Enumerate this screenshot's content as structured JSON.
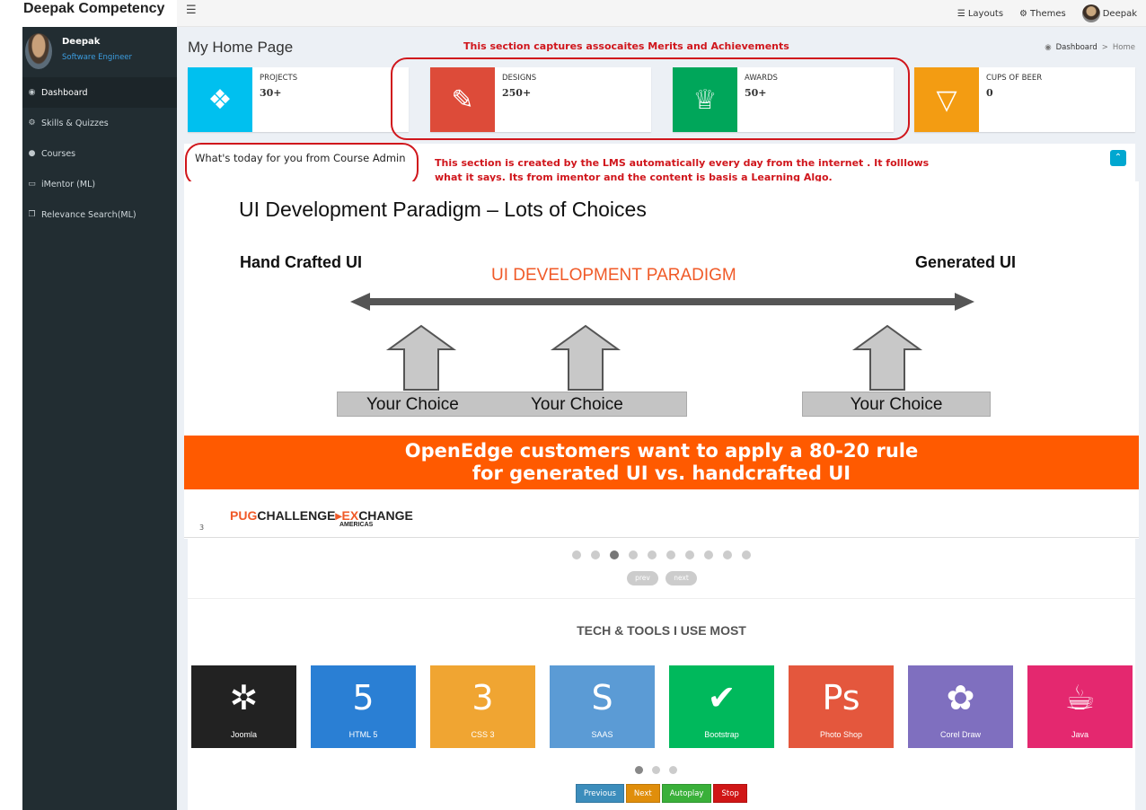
{
  "app": {
    "title": "Deepak Competency"
  },
  "topnav": {
    "layouts": "Layouts",
    "themes": "Themes",
    "user": "Deepak"
  },
  "sidebar": {
    "user_name": "Deepak",
    "user_role": "Software Engineer",
    "items": [
      {
        "label": "Dashboard",
        "icon": "dashboard-icon",
        "active": true
      },
      {
        "label": "Skills & Quizzes",
        "icon": "cogs-icon",
        "active": false
      },
      {
        "label": "Courses",
        "icon": "globe-icon",
        "active": false
      },
      {
        "label": "iMentor (ML)",
        "icon": "laptop-icon",
        "active": false
      },
      {
        "label": "Relevance Search(ML)",
        "icon": "copy-icon",
        "active": false
      }
    ]
  },
  "page": {
    "title": "My Home Page",
    "breadcrumb": [
      "Dashboard",
      "Home"
    ]
  },
  "annotations": {
    "merits": "This section captures assocaites Merits and Achievements",
    "lms": "This section is created by the LMS automatically every day from the internet . It folllows what it says. Its from imentor and the content is basis a Learning Algo."
  },
  "info_boxes": [
    {
      "label": "PROJECTS",
      "value": "30+",
      "color": "#00c0ef",
      "icon": "puzzle-icon"
    },
    {
      "label": "DESIGNS",
      "value": "250+",
      "color": "#dd4b39",
      "icon": "paintbrush-icon"
    },
    {
      "label": "AWARDS",
      "value": "50+",
      "color": "#00a65a",
      "icon": "trophy-icon"
    },
    {
      "label": "CUPS OF BEER",
      "value": "0",
      "color": "#f39c12",
      "icon": "glass-icon"
    }
  ],
  "news": {
    "title": "What's today for you from Course Admin"
  },
  "slide": {
    "title": "UI Development Paradigm – Lots of Choices",
    "left": "Hand Crafted UI",
    "center": "UI DEVELOPMENT PARADIGM",
    "right": "Generated UI",
    "choices": [
      "Your Choice",
      "Your Choice",
      "Your Choice"
    ],
    "banner_line1": "OpenEdge customers want to apply a 80-20 rule",
    "banner_line2": "for generated UI vs. handcrafted UI",
    "logo_part1": "PUG",
    "logo_part2": "CHALLENGE",
    "logo_part3": "▸E",
    "logo_part4": "X",
    "logo_part5": "CHANGE",
    "logo_sub": "AMERICAS",
    "page_number": "3"
  },
  "slider": {
    "dot_count": 10,
    "active_dot": 2,
    "prev": "prev",
    "next": "next"
  },
  "tools": {
    "heading": "TECH & TOOLS I USE MOST",
    "items": [
      {
        "name": "Joomla",
        "color": "#222222",
        "glyph": "✲"
      },
      {
        "name": "HTML 5",
        "color": "#2a7fd4",
        "glyph": "5"
      },
      {
        "name": "CSS 3",
        "color": "#f0a532",
        "glyph": "3"
      },
      {
        "name": "SAAS",
        "color": "#5b9bd5",
        "glyph": "S"
      },
      {
        "name": "Bootstrap",
        "color": "#00b95c",
        "glyph": "✔"
      },
      {
        "name": "Photo Shop",
        "color": "#e4573d",
        "glyph": "Ps"
      },
      {
        "name": "Corel Draw",
        "color": "#7f6fbf",
        "glyph": "✿"
      },
      {
        "name": "Java",
        "color": "#e4286f",
        "glyph": "☕"
      }
    ],
    "dots": 3,
    "active_dot": 0
  },
  "controls": {
    "previous": "Previous",
    "next": "Next",
    "autoplay": "Autoplay",
    "stop": "Stop",
    "colors": {
      "previous": "#3c8dbc",
      "next": "#e08e0b",
      "autoplay": "#3ab03a",
      "stop": "#d01616"
    }
  }
}
